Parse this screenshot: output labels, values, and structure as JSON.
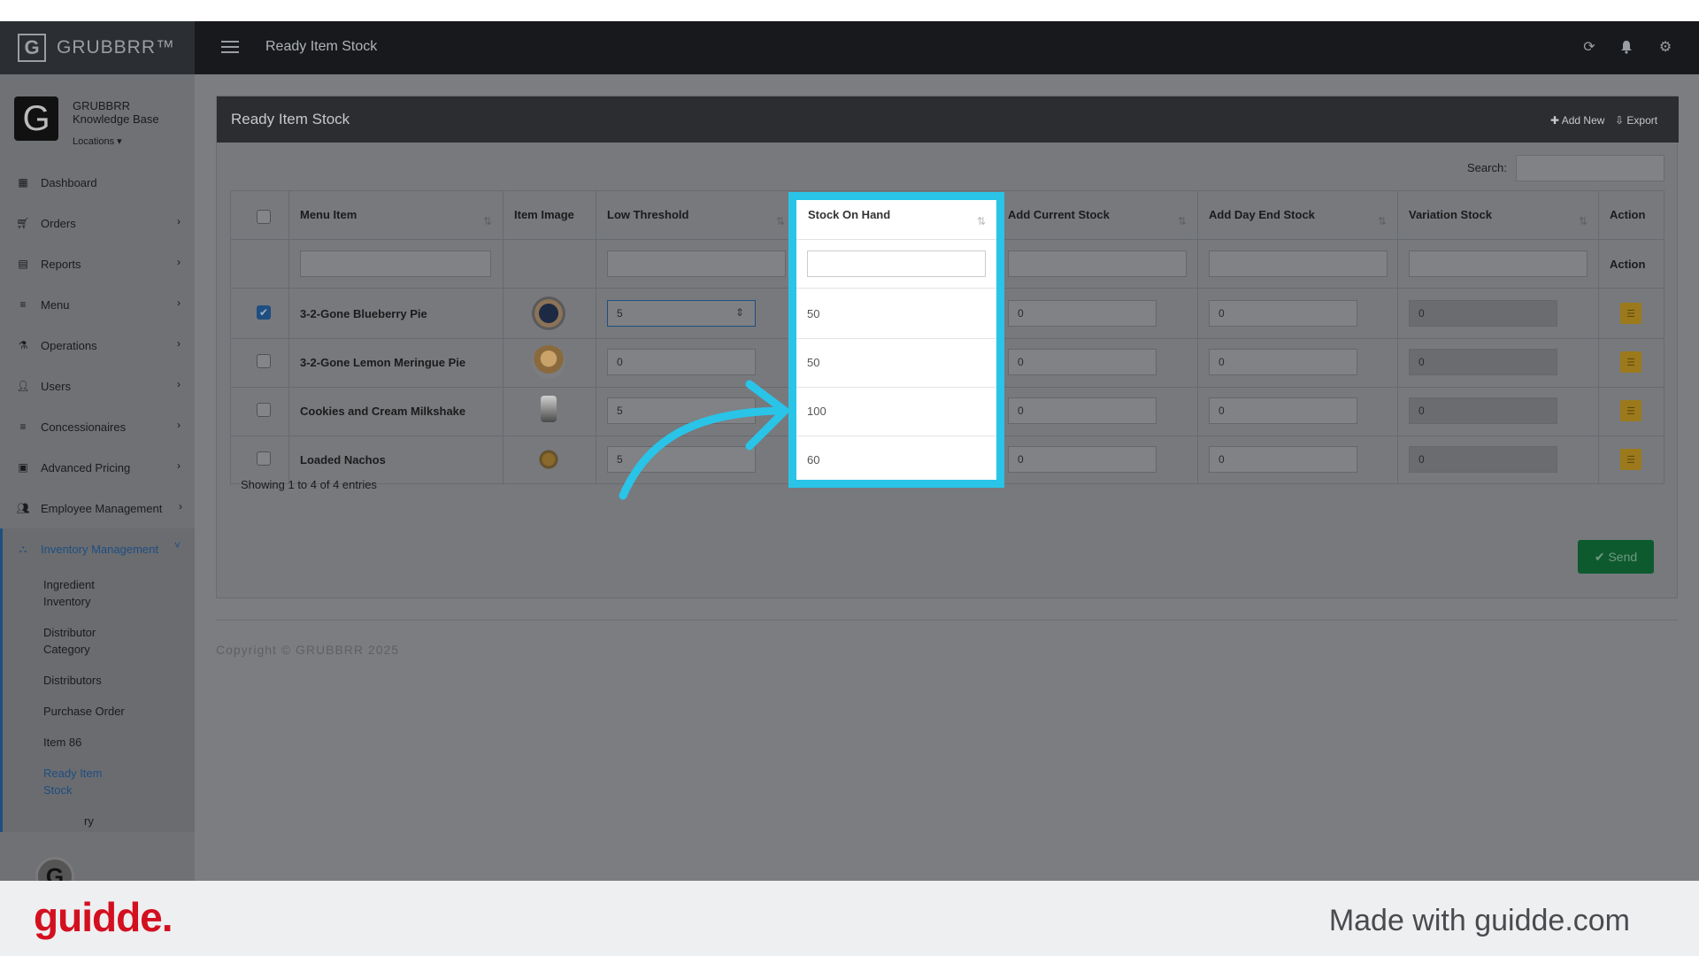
{
  "app": {
    "brand": "GRUBBRR™",
    "brand_letter": "G",
    "page_title": "Ready Item Stock"
  },
  "topbar_icons": [
    "refresh-icon",
    "bell-icon",
    "gear-icon"
  ],
  "profile": {
    "name": "GRUBBRR Knowledge Base",
    "locations": "Locations ▾"
  },
  "sidebar": {
    "items": [
      {
        "label": "Dashboard",
        "icon": "dashboard-icon",
        "chevron": ""
      },
      {
        "label": "Orders",
        "icon": "cart-icon",
        "chevron": "›"
      },
      {
        "label": "Reports",
        "icon": "file-icon",
        "chevron": "›"
      },
      {
        "label": "Menu",
        "icon": "list-icon",
        "chevron": "›"
      },
      {
        "label": "Operations",
        "icon": "flask-icon",
        "chevron": "›"
      },
      {
        "label": "Users",
        "icon": "user-plus-icon",
        "chevron": "›"
      },
      {
        "label": "Concessionaires",
        "icon": "list-icon",
        "chevron": "›"
      },
      {
        "label": "Advanced Pricing",
        "icon": "money-icon",
        "chevron": "›"
      },
      {
        "label": "Employee Management",
        "icon": "users-icon",
        "chevron": "›"
      },
      {
        "label": "Inventory Management",
        "icon": "sitemap-icon",
        "chevron": "˅"
      }
    ],
    "subitems": [
      {
        "label": "Ingredient Inventory"
      },
      {
        "label": "Distributor Category"
      },
      {
        "label": "Distributors"
      },
      {
        "label": "Purchase Order"
      },
      {
        "label": "Item 86"
      },
      {
        "label": "Ready Item Stock"
      },
      {
        "label": "ry"
      }
    ]
  },
  "panel": {
    "title": "Ready Item Stock",
    "add_new": "✚ Add New",
    "export": "⇩ Export",
    "search_label": "Search:"
  },
  "table": {
    "headers": {
      "menu_item": "Menu Item",
      "item_image": "Item Image",
      "low_threshold": "Low Threshold",
      "stock_on_hand": "Stock On Hand",
      "add_current_stock": "Add Current Stock",
      "add_day_end_stock": "Add Day End Stock",
      "variation_stock": "Variation Stock",
      "action": "Action"
    },
    "filter_action_label": "Action",
    "rows": [
      {
        "checked": true,
        "name": "3-2-Gone Blueberry Pie",
        "low_threshold": "5",
        "stock_on_hand": "50",
        "add_current_stock": "0",
        "add_day_end_stock": "0",
        "variation_stock": "0"
      },
      {
        "checked": false,
        "name": "3-2-Gone Lemon Meringue Pie",
        "low_threshold": "0",
        "stock_on_hand": "50",
        "add_current_stock": "0",
        "add_day_end_stock": "0",
        "variation_stock": "0"
      },
      {
        "checked": false,
        "name": "Cookies and Cream Milkshake",
        "low_threshold": "5",
        "stock_on_hand": "100",
        "add_current_stock": "0",
        "add_day_end_stock": "0",
        "variation_stock": "0"
      },
      {
        "checked": false,
        "name": "Loaded Nachos",
        "low_threshold": "5",
        "stock_on_hand": "60",
        "add_current_stock": "0",
        "add_day_end_stock": "0",
        "variation_stock": "0"
      }
    ],
    "footer": "Showing 1 to 4 of 4 entries"
  },
  "send_button": "✔ Send",
  "copyright": "Copyright © GRUBBRR 2025",
  "guidde": {
    "logo": "guidde.",
    "made_with": "Made with guidde.com"
  },
  "colors": {
    "highlight": "#29c4e8",
    "arrow": "#29c4e8",
    "guidde_red": "#d3101f",
    "send_green": "#0e5a2f"
  }
}
